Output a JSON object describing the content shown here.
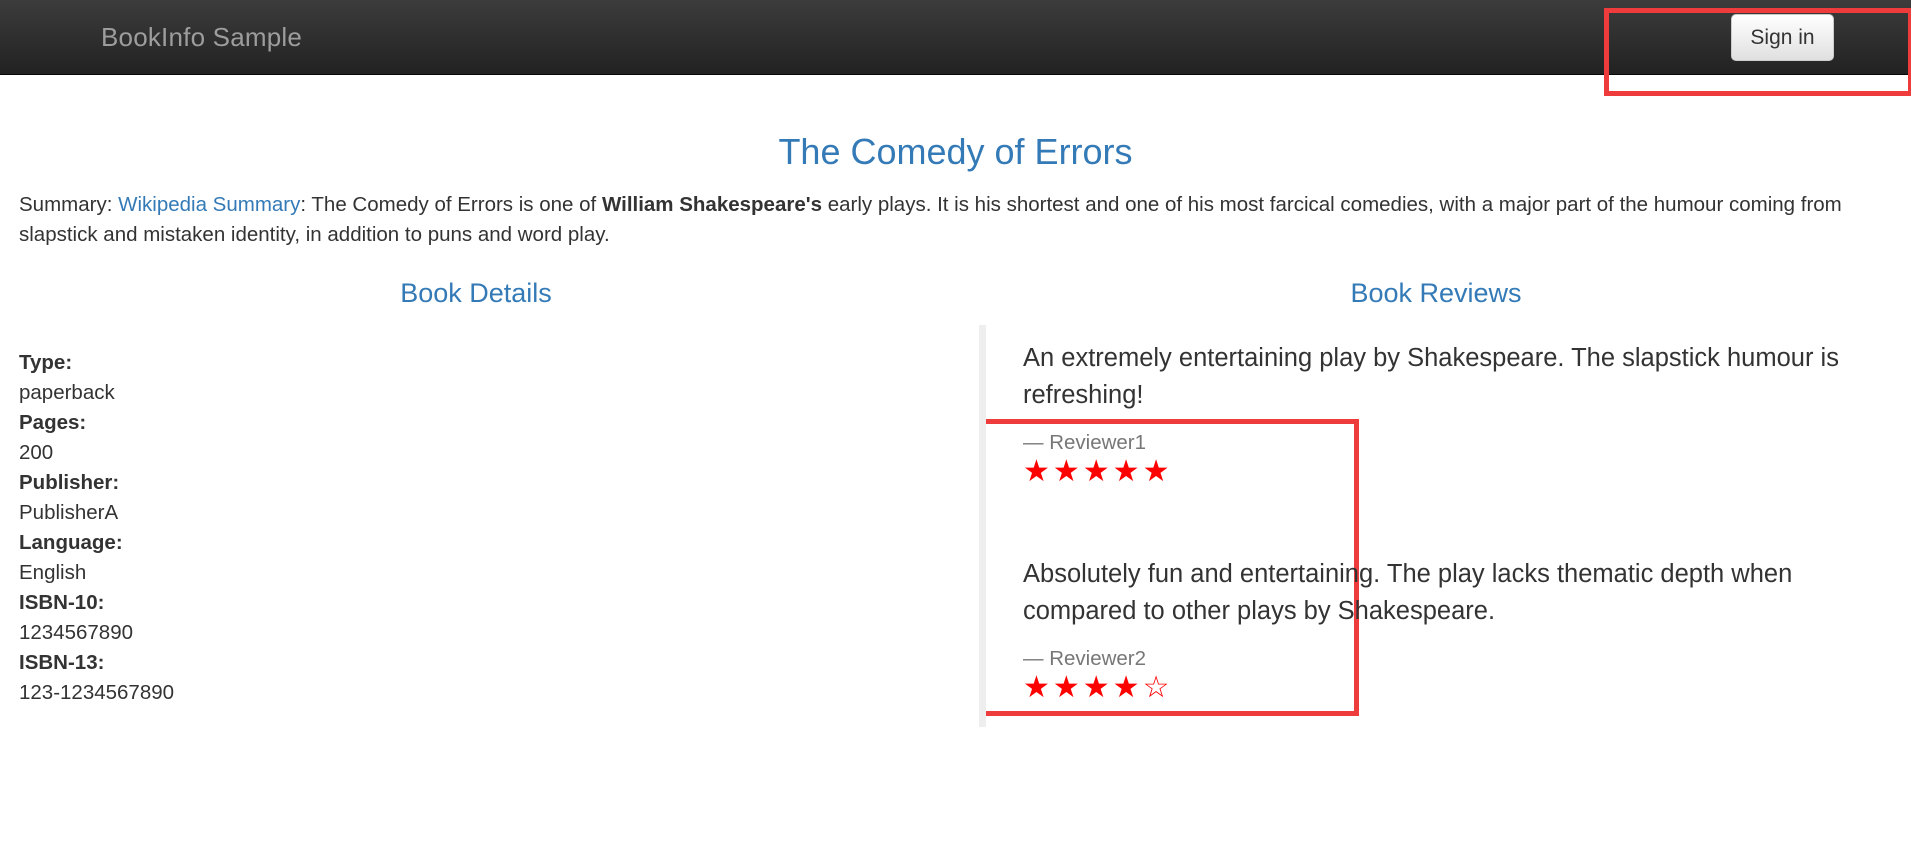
{
  "navbar": {
    "brand": "BookInfo Sample",
    "signin_label": "Sign in"
  },
  "product": {
    "title": "The Comedy of Errors",
    "summary_prefix": "Summary: ",
    "summary_link": "Wikipedia Summary",
    "summary_text_1": ": The Comedy of Errors is one of ",
    "summary_bold": "William Shakespeare's",
    "summary_text_2": " early plays. It is his shortest and one of his most farcical comedies, with a major part of the humour coming from slapstick and mistaken identity, in addition to puns and word play."
  },
  "details": {
    "heading": "Book Details",
    "items": [
      {
        "label": "Type:",
        "value": "paperback"
      },
      {
        "label": "Pages:",
        "value": "200"
      },
      {
        "label": "Publisher:",
        "value": "PublisherA"
      },
      {
        "label": "Language:",
        "value": "English"
      },
      {
        "label": "ISBN-10:",
        "value": "1234567890"
      },
      {
        "label": "ISBN-13:",
        "value": "123-1234567890"
      }
    ]
  },
  "reviews": {
    "heading": "Book Reviews",
    "items": [
      {
        "text": "An extremely entertaining play by Shakespeare. The slapstick humour is refreshing!",
        "reviewer": "— Reviewer1",
        "stars": "★★★★★",
        "rating": 5,
        "rating_max": 5
      },
      {
        "text": "Absolutely fun and entertaining. The play lacks thematic depth when compared to other plays by Shakespeare.",
        "reviewer": "— Reviewer2",
        "stars": "★★★★☆",
        "rating": 4,
        "rating_max": 5
      }
    ]
  },
  "colors": {
    "navbar": "#222222",
    "brand_text": "#9d9d9d",
    "link": "#337ab7",
    "star": "#ff0000",
    "annotation_box": "#ee3b3b"
  }
}
